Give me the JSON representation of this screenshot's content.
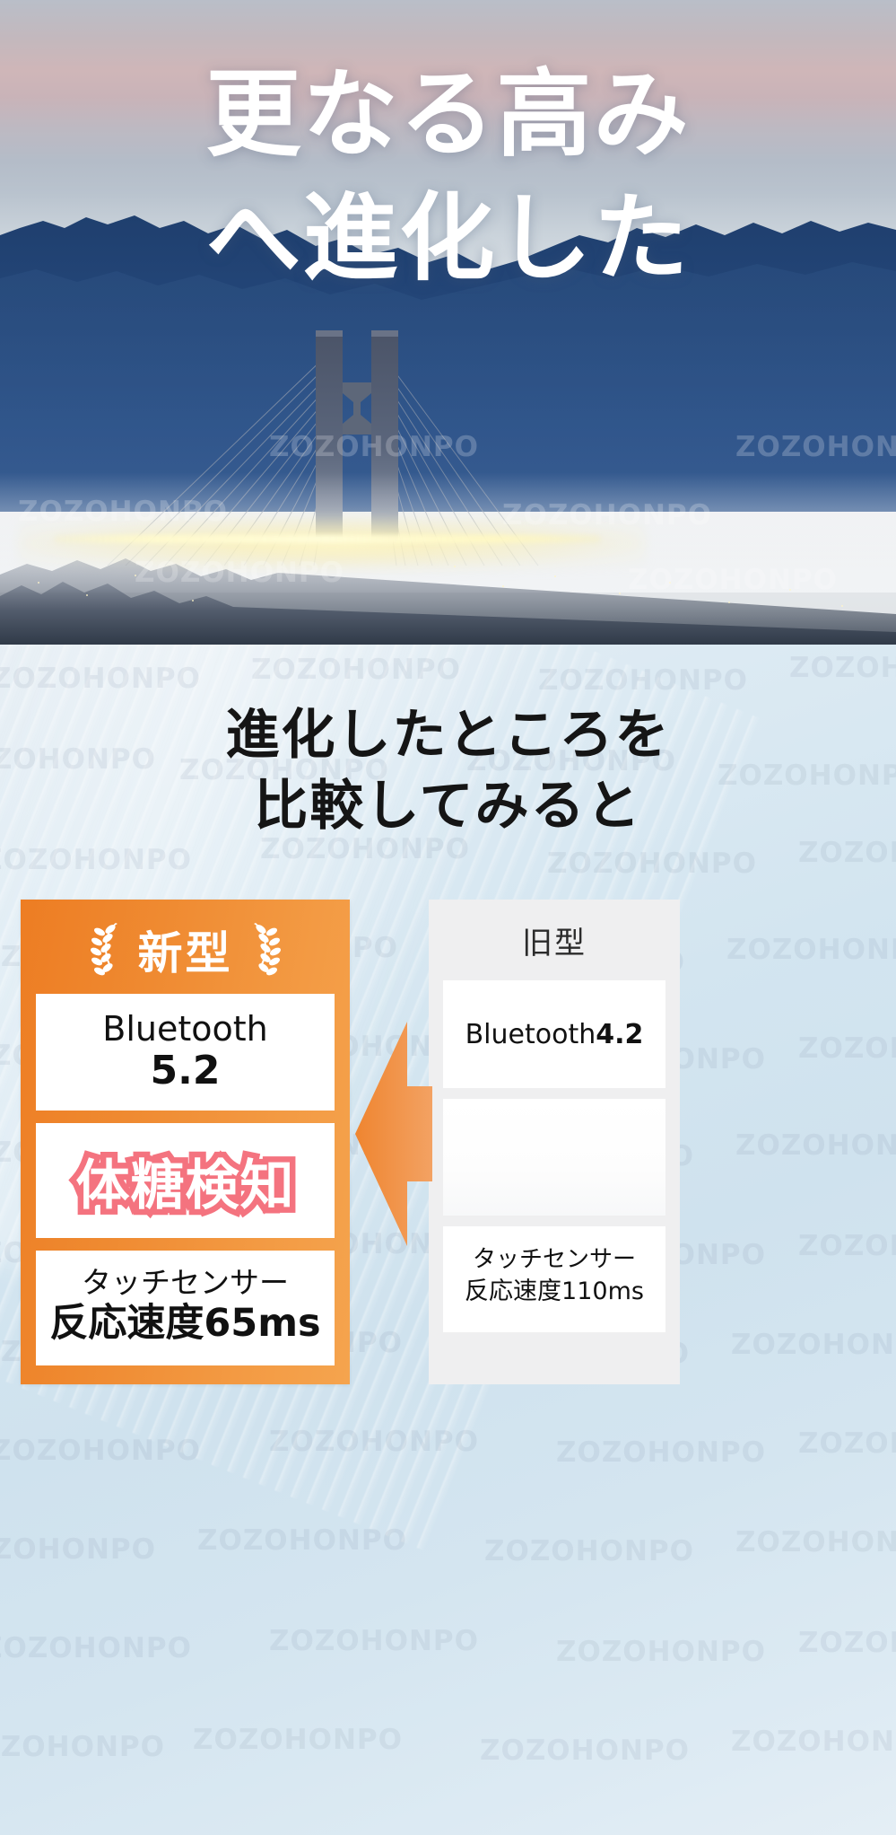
{
  "hero": {
    "headline_line1": "更なる高み",
    "headline_line2": "へ進化した",
    "watermark": "ZOZOHONPO"
  },
  "lower": {
    "heading_line1": "進化したところを",
    "heading_line2": "比較してみると",
    "watermark": "ZOZOHONPO"
  },
  "colors": {
    "orange_start": "#ED7D23",
    "orange_end": "#F5A44E",
    "arrow": "#F0873B",
    "pink": "#F4737F",
    "old_card_bg": "#EFEFF0",
    "bg_blue": "#D3E5F0",
    "text_dark": "#151515"
  },
  "compare": {
    "new_card": {
      "title": "新型",
      "left_icon": "laurel-left-icon",
      "right_icon": "laurel-right-icon",
      "rows": [
        {
          "name": "bluetooth",
          "line1": "Bluetooth",
          "line2": "5.2"
        },
        {
          "name": "glucose-detection",
          "line1": "体糖検知"
        },
        {
          "name": "touch-sensor",
          "line1": "タッチセンサー",
          "line2": "反応速度65ms"
        }
      ]
    },
    "old_card": {
      "title": "旧型",
      "rows": [
        {
          "name": "bluetooth",
          "prefix": "Bluetooth",
          "value": "4.2"
        },
        {
          "name": "blank"
        },
        {
          "name": "touch-sensor",
          "line1": "タッチセンサー",
          "line2": "反応速度110ms"
        }
      ]
    },
    "arrow_icon": "arrow-left-icon"
  }
}
